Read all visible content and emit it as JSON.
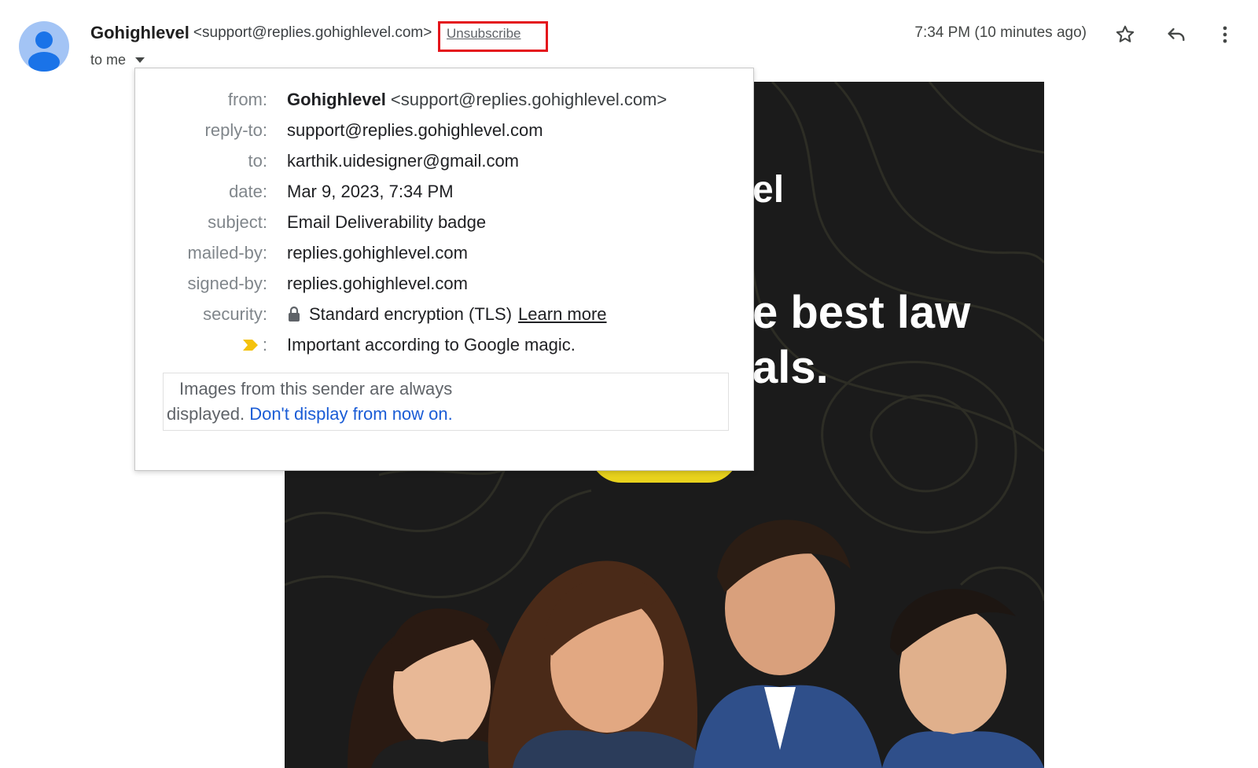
{
  "header": {
    "sender_name": "Gohighlevel",
    "sender_email": "<support@replies.gohighlevel.com>",
    "unsubscribe_label": "Unsubscribe",
    "recipient_label": "to me",
    "timestamp": "7:34 PM (10 minutes ago)",
    "icons": [
      "star-icon",
      "reply-icon",
      "more-vert-icon"
    ]
  },
  "details": {
    "from_label": "from:",
    "from_name": "Gohighlevel",
    "from_email": "<support@replies.gohighlevel.com>",
    "reply_to_label": "reply-to:",
    "reply_to_value": "support@replies.gohighlevel.com",
    "to_label": "to:",
    "to_value": "karthik.uidesigner@gmail.com",
    "date_label": "date:",
    "date_value": "Mar 9, 2023, 7:34 PM",
    "subject_label": "subject:",
    "subject_value": "Email Deliverability badge",
    "mailed_by_label": "mailed-by:",
    "mailed_by_value": "replies.gohighlevel.com",
    "signed_by_label": "signed-by:",
    "signed_by_value": "replies.gohighlevel.com",
    "security_label": "security:",
    "security_value": "Standard encryption (TLS)",
    "learn_more_label": "Learn more",
    "importance_label": ":",
    "importance_value": "Important according to Google magic.",
    "images_note_line1": "Images from this sender are always",
    "images_note_line2": "displayed.",
    "dont_display_link": "Don't display from now on."
  },
  "email_body": {
    "fragment_1": "el",
    "fragment_2": "e best law",
    "fragment_3": "als."
  },
  "colors": {
    "unsubscribe_highlight": "#e4141b",
    "link_blue": "#1a5cd6",
    "importance_yellow": "#f4c20d",
    "email_background": "#1b1b1b",
    "cta_yellow": "#e8d21d"
  }
}
